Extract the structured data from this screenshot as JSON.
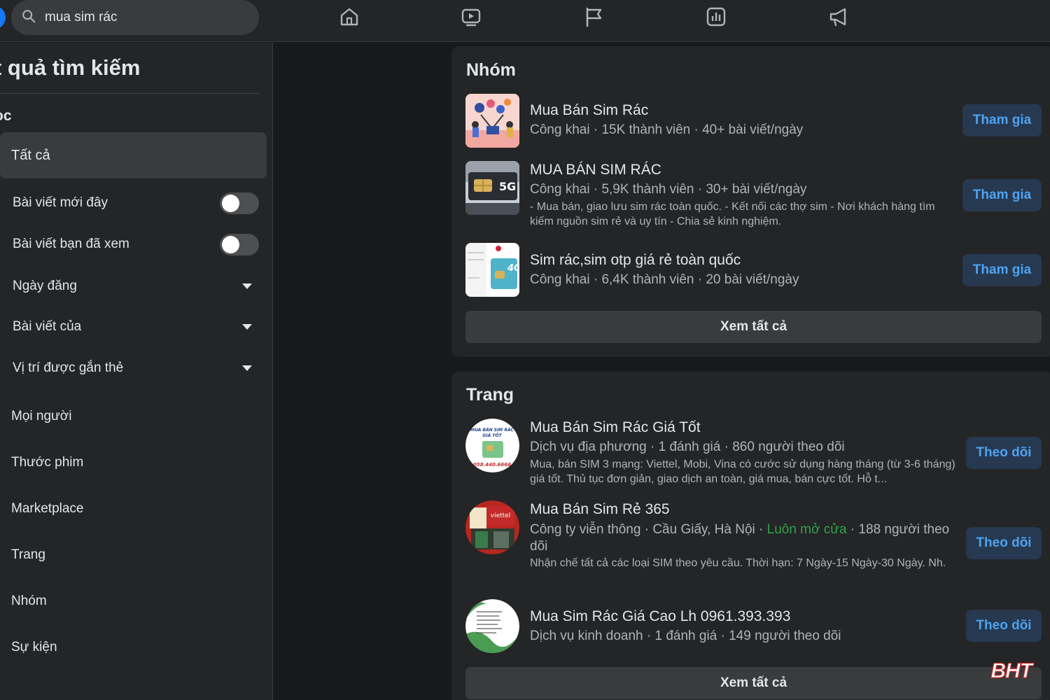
{
  "search": {
    "value": "mua sim rác"
  },
  "nav": {
    "icons": [
      "home-icon",
      "watch-icon",
      "pages-flag-icon",
      "gaming-chart-icon",
      "ads-megaphone-icon"
    ]
  },
  "sidebar": {
    "title": "t quả tìm kiếm",
    "section": "ọc",
    "all_label": "Tất cả",
    "toggles": [
      {
        "label": "Bài viết mới đây",
        "on": false
      },
      {
        "label": "Bài viết bạn đã xem",
        "on": false
      }
    ],
    "dropdowns": [
      {
        "label": "Ngày đăng"
      },
      {
        "label": "Bài viết của"
      },
      {
        "label": "Vị trí được gắn thẻ"
      }
    ],
    "categories": [
      "Mọi người",
      "Thước phim",
      "Marketplace",
      "Trang",
      "Nhóm",
      "Sự kiện"
    ]
  },
  "groups": {
    "title": "Nhóm",
    "items": [
      {
        "name": "Mua Bán Sim Rác",
        "meta": "Công khai · 15K thành viên · 40+ bài viết/ngày",
        "desc": "",
        "button": "Tham gia"
      },
      {
        "name": "MUA BÁN SIM RÁC",
        "meta": "Công khai · 5,9K thành viên · 30+ bài viết/ngày",
        "desc": "- Mua bán, giao lưu sim rác toàn quốc. - Kết nối các thợ sim - Nơi khách hàng tìm kiếm nguồn sim rẻ và uy tín - Chia sẻ kinh nghiệm.",
        "button": "Tham gia",
        "thumb_text": "5G"
      },
      {
        "name": "Sim rác,sim otp giá rẻ toàn quốc",
        "meta": "Công khai · 6,4K thành viên · 20 bài viết/ngày",
        "desc": "",
        "button": "Tham gia",
        "thumb_text": "4G"
      }
    ],
    "see_all": "Xem tất cả"
  },
  "pages": {
    "title": "Trang",
    "items": [
      {
        "name": "Mua Bán Sim Rác Giá Tốt",
        "meta": "Dịch vụ địa phương · 1 đánh giá · 860 người theo dõi",
        "desc": "Mua, bán SIM 3 mạng: Viettel, Mobi, Vina có cước sử dụng hàng tháng (từ 3-6 tháng) giá tốt. Thủ tục đơn giản, giao dịch an toàn, giá mua, bán cực tốt. Hỗ t...",
        "button": "Theo dõi",
        "thumb_text_1": "MUA BÁN SIM RÁC",
        "thumb_text_2": "GIÁ TỐT",
        "thumb_text_3": "058.440.6666"
      },
      {
        "name": "Mua Bán Sim Rẻ 365",
        "meta_prefix": "Công ty viễn thông · Cầu Giấy, Hà Nội · ",
        "meta_open": "Luôn mở cửa",
        "meta_suffix": " · 188 người theo dõi",
        "desc": "Nhận chế tất cả các loại SIM theo yêu cầu. Thời hạn: 7 Ngày-15 Ngày-30 Ngày. Nh.",
        "button": "Theo dõi",
        "thumb_text": "viettel"
      },
      {
        "name": "Mua Sim Rác Giá Cao Lh 0961.393.393",
        "meta": "Dịch vụ kinh doanh · 1 đánh giá · 149 người theo dõi",
        "desc": "",
        "button": "Theo dõi"
      }
    ],
    "see_all": "Xem tất cả"
  },
  "watermark": "BHT",
  "colors": {
    "background": "#18191a",
    "surface": "#242526",
    "accent_button_bg": "#263951",
    "accent_button_text": "#4ea3f0",
    "open_status": "#31a24c"
  }
}
